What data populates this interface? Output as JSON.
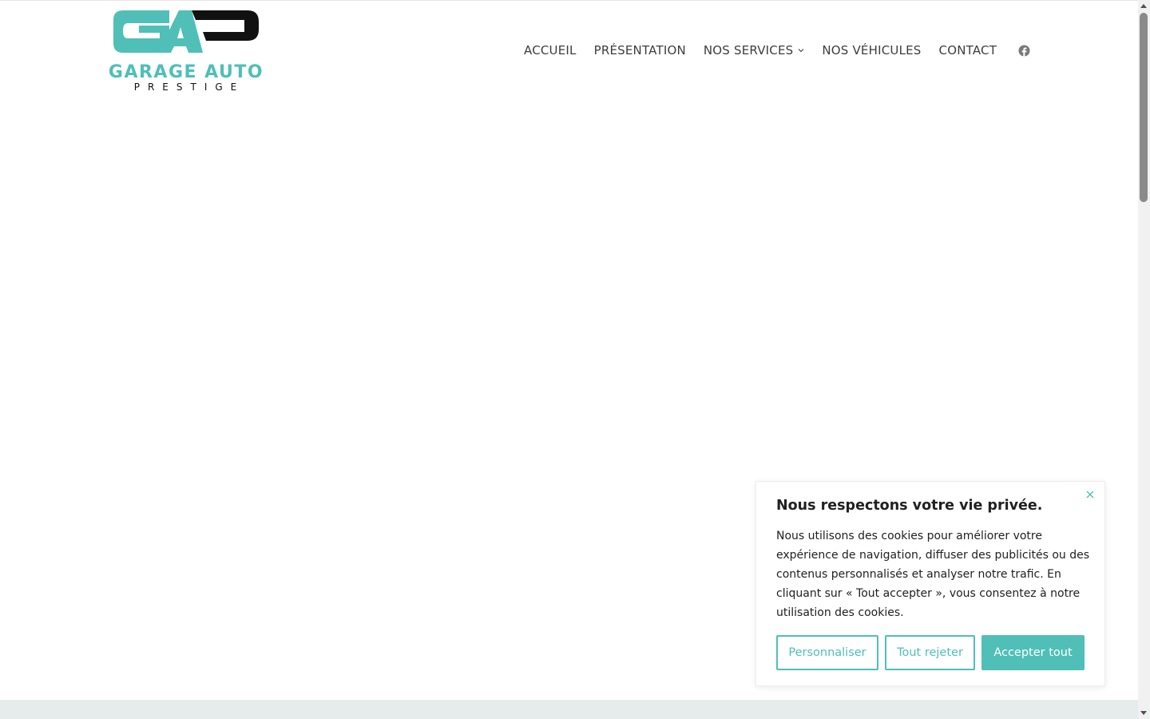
{
  "brand": {
    "logo_line1": "GARAGE AUTO",
    "logo_line2": "PRESTIGE",
    "accent_color": "#4fbfb8"
  },
  "nav": {
    "items": [
      {
        "label": "ACCUEIL"
      },
      {
        "label": "PRÉSENTATION"
      },
      {
        "label": "NOS SERVICES",
        "has_dropdown": true
      },
      {
        "label": "NOS VÉHICULES"
      },
      {
        "label": "CONTACT"
      }
    ],
    "social_icon": "facebook-icon"
  },
  "cookie_banner": {
    "title": "Nous respectons votre vie privée.",
    "text": "Nous utilisons des cookies pour améliorer votre expérience de navigation, diffuser des publicités ou des contenus personnalisés et analyser notre trafic. En cliquant sur « Tout accepter », vous consentez à notre utilisation des cookies.",
    "customize_label": "Personnaliser",
    "reject_label": "Tout rejeter",
    "accept_label": "Accepter tout",
    "close_icon": "close-icon"
  }
}
